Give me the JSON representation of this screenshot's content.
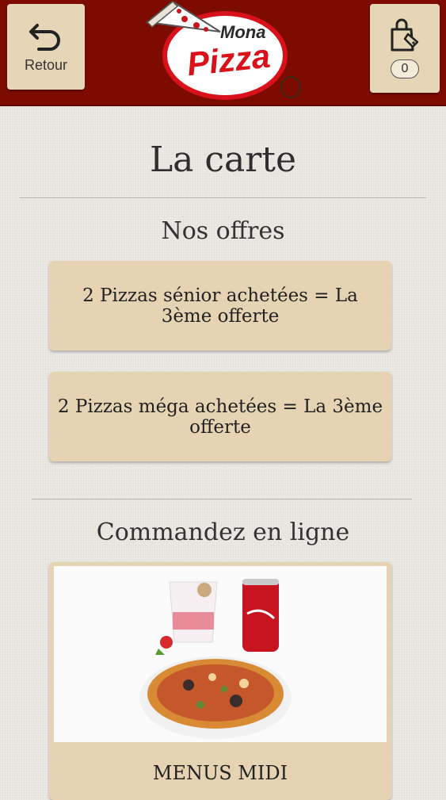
{
  "header": {
    "back_label": "Retour",
    "back_icon": "back-arrow-icon",
    "cart_icon": "shopping-bag-icon",
    "cart_count": "0",
    "logo_text_top": "Mona",
    "logo_text_main": "Pizza",
    "brand_color": "#7e0b00",
    "logo_red": "#d9111a"
  },
  "main": {
    "title": "La carte",
    "offers_heading": "Nos offres",
    "offers": [
      {
        "label": "2 Pizzas sénior achetées = La 3ème offerte"
      },
      {
        "label": "2 Pizzas méga achetées = La 3ème offerte"
      }
    ],
    "order_heading": "Commandez en ligne",
    "categories": [
      {
        "label": "MENUS MIDI",
        "image": "pizza-menu-photo"
      }
    ]
  },
  "colors": {
    "button_bg": "#e5d3b3",
    "page_bg": "#ece9e3"
  }
}
